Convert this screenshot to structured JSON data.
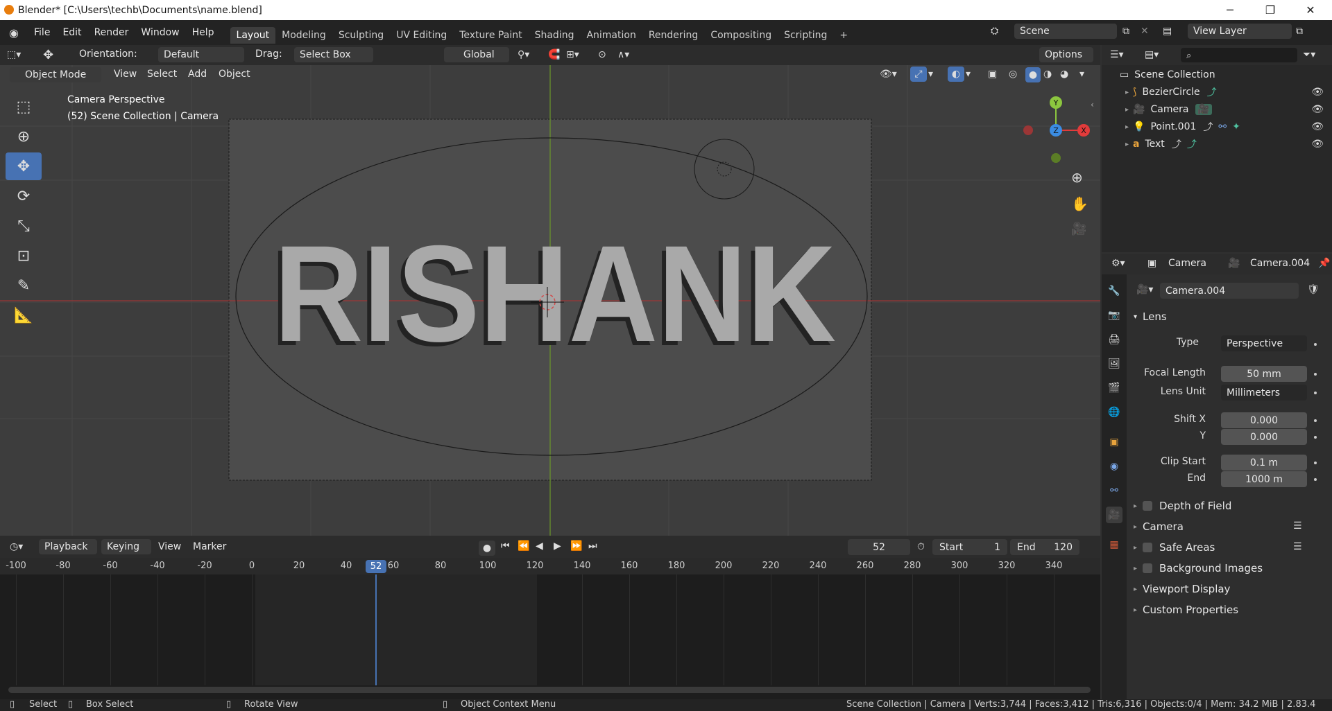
{
  "window": {
    "title": "Blender* [C:\\Users\\techb\\Documents\\name.blend]",
    "minimize": "─",
    "maximize": "❐",
    "close": "✕"
  },
  "menu": [
    "File",
    "Edit",
    "Render",
    "Window",
    "Help"
  ],
  "workspaces": [
    "Layout",
    "Modeling",
    "Sculpting",
    "UV Editing",
    "Texture Paint",
    "Shading",
    "Animation",
    "Rendering",
    "Compositing",
    "Scripting"
  ],
  "active_workspace": "Layout",
  "add_workspace": "+",
  "scene": "Scene",
  "view_layer": "View Layer",
  "tool_header": {
    "orientation_label": "Orientation:",
    "orientation_value": "Default",
    "drag_label": "Drag:",
    "drag_value": "Select Box",
    "transform": "Global",
    "options": "Options"
  },
  "viewport_header": {
    "mode": "Object Mode",
    "view": "View",
    "select": "Select",
    "add": "Add",
    "object": "Object"
  },
  "viewport": {
    "info_line1": "Camera Perspective",
    "info_line2": "(52) Scene Collection | Camera",
    "text_object": "RISHANK",
    "gizmo_x": "X",
    "gizmo_y": "Y",
    "gizmo_z": "Z"
  },
  "outliner": {
    "root": "Scene Collection",
    "items": [
      {
        "name": "BezierCircle",
        "icon": "curve-icon",
        "color": "#e8a33c"
      },
      {
        "name": "Camera",
        "icon": "camera-icon",
        "color": "#e8a33c"
      },
      {
        "name": "Point.001",
        "icon": "light-icon",
        "color": "#e8a33c"
      },
      {
        "name": "Text",
        "icon": "text-icon",
        "color": "#e8a33c"
      }
    ]
  },
  "properties": {
    "object_name": "Camera",
    "data_name": "Camera.004",
    "datablock": "Camera.004",
    "lens_section": "Lens",
    "type_label": "Type",
    "type_value": "Perspective",
    "focal_label": "Focal Length",
    "focal_value": "50 mm",
    "lens_unit_label": "Lens Unit",
    "lens_unit_value": "Millimeters",
    "shiftx_label": "Shift X",
    "shiftx_value": "0.000",
    "shifty_label": "Y",
    "shifty_value": "0.000",
    "clip_start_label": "Clip Start",
    "clip_start_value": "0.1 m",
    "clip_end_label": "End",
    "clip_end_value": "1000 m",
    "sections": [
      "Depth of Field",
      "Camera",
      "Safe Areas",
      "Background Images",
      "Viewport Display",
      "Custom Properties"
    ]
  },
  "timeline": {
    "playback": "Playback",
    "keying": "Keying",
    "view": "View",
    "marker": "Marker",
    "current_frame": "52",
    "start_label": "Start",
    "start": "1",
    "end_label": "End",
    "end": "120",
    "ticks": [
      "-100",
      "-80",
      "-60",
      "-40",
      "-20",
      "0",
      "20",
      "40",
      "60",
      "80",
      "100",
      "120",
      "140",
      "160",
      "180",
      "200",
      "220",
      "240",
      "260",
      "280",
      "300",
      "320",
      "340"
    ]
  },
  "status": {
    "select": "Select",
    "box_select": "Box Select",
    "rotate_view": "Rotate View",
    "context_menu": "Object Context Menu",
    "stats": "Scene Collection | Camera | Verts:3,744 | Faces:3,412 | Tris:6,316 | Objects:0/4 | Mem: 34.2 MiB | 2.83.4"
  },
  "colors": {
    "accent": "#4772b3",
    "x_axis": "#e23b3b",
    "y_axis": "#8cc63f",
    "z_axis": "#3b8ce2"
  }
}
